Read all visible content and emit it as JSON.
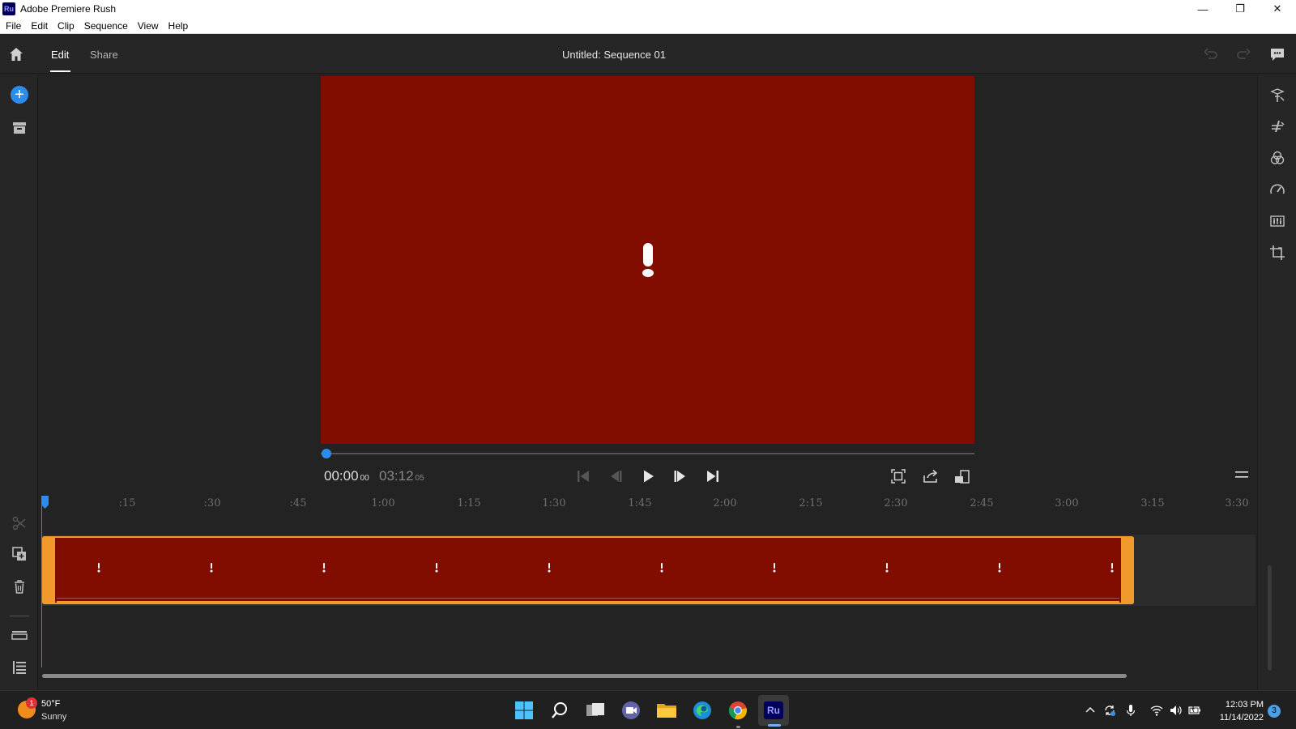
{
  "window": {
    "logo": "Ru",
    "title": "Adobe Premiere Rush",
    "minimize": "—",
    "maximize": "❐",
    "close": "✕"
  },
  "menu": [
    "File",
    "Edit",
    "Clip",
    "Sequence",
    "View",
    "Help"
  ],
  "header": {
    "tabs": {
      "edit": "Edit",
      "share": "Share"
    },
    "sequence_title": "Untitled: Sequence 01"
  },
  "left_toolbar": {
    "add": "+"
  },
  "player": {
    "current_time": "00:00",
    "current_frames": "00",
    "total_time": "03:12",
    "total_frames": "05"
  },
  "timeline": {
    "ruler_ticks": [
      ":15",
      ":30",
      ":45",
      "1:00",
      "1:15",
      "1:30",
      "1:45",
      "2:00",
      "2:15",
      "2:30",
      "2:45",
      "3:00",
      "3:15",
      "3:30"
    ]
  },
  "taskbar": {
    "weather_temp": "50°F",
    "weather_condition": "Sunny",
    "weather_badge": "1",
    "rush_label": "Ru",
    "clock_time": "12:03 PM",
    "clock_date": "11/14/2022",
    "notification_count": "3"
  },
  "colors": {
    "accent_blue": "#2d8ceb",
    "clip_red": "#810d00",
    "clip_border_orange": "#f19a2b",
    "panel_bg": "#232323"
  }
}
